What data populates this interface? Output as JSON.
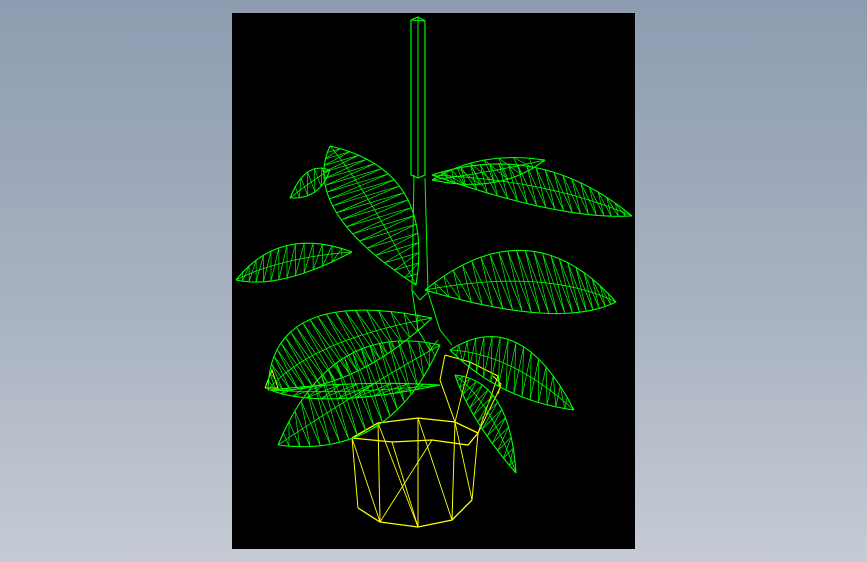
{
  "viewport": {
    "background_top": "#8e9cb1",
    "background_bottom": "#c6cbd4"
  },
  "canvas": {
    "background": "#000000"
  },
  "model": {
    "subject": "potted-plant-wireframe",
    "leaf_color": "#00ff00",
    "pot_color": "#ffff00",
    "stem_color": "#00ff00"
  }
}
